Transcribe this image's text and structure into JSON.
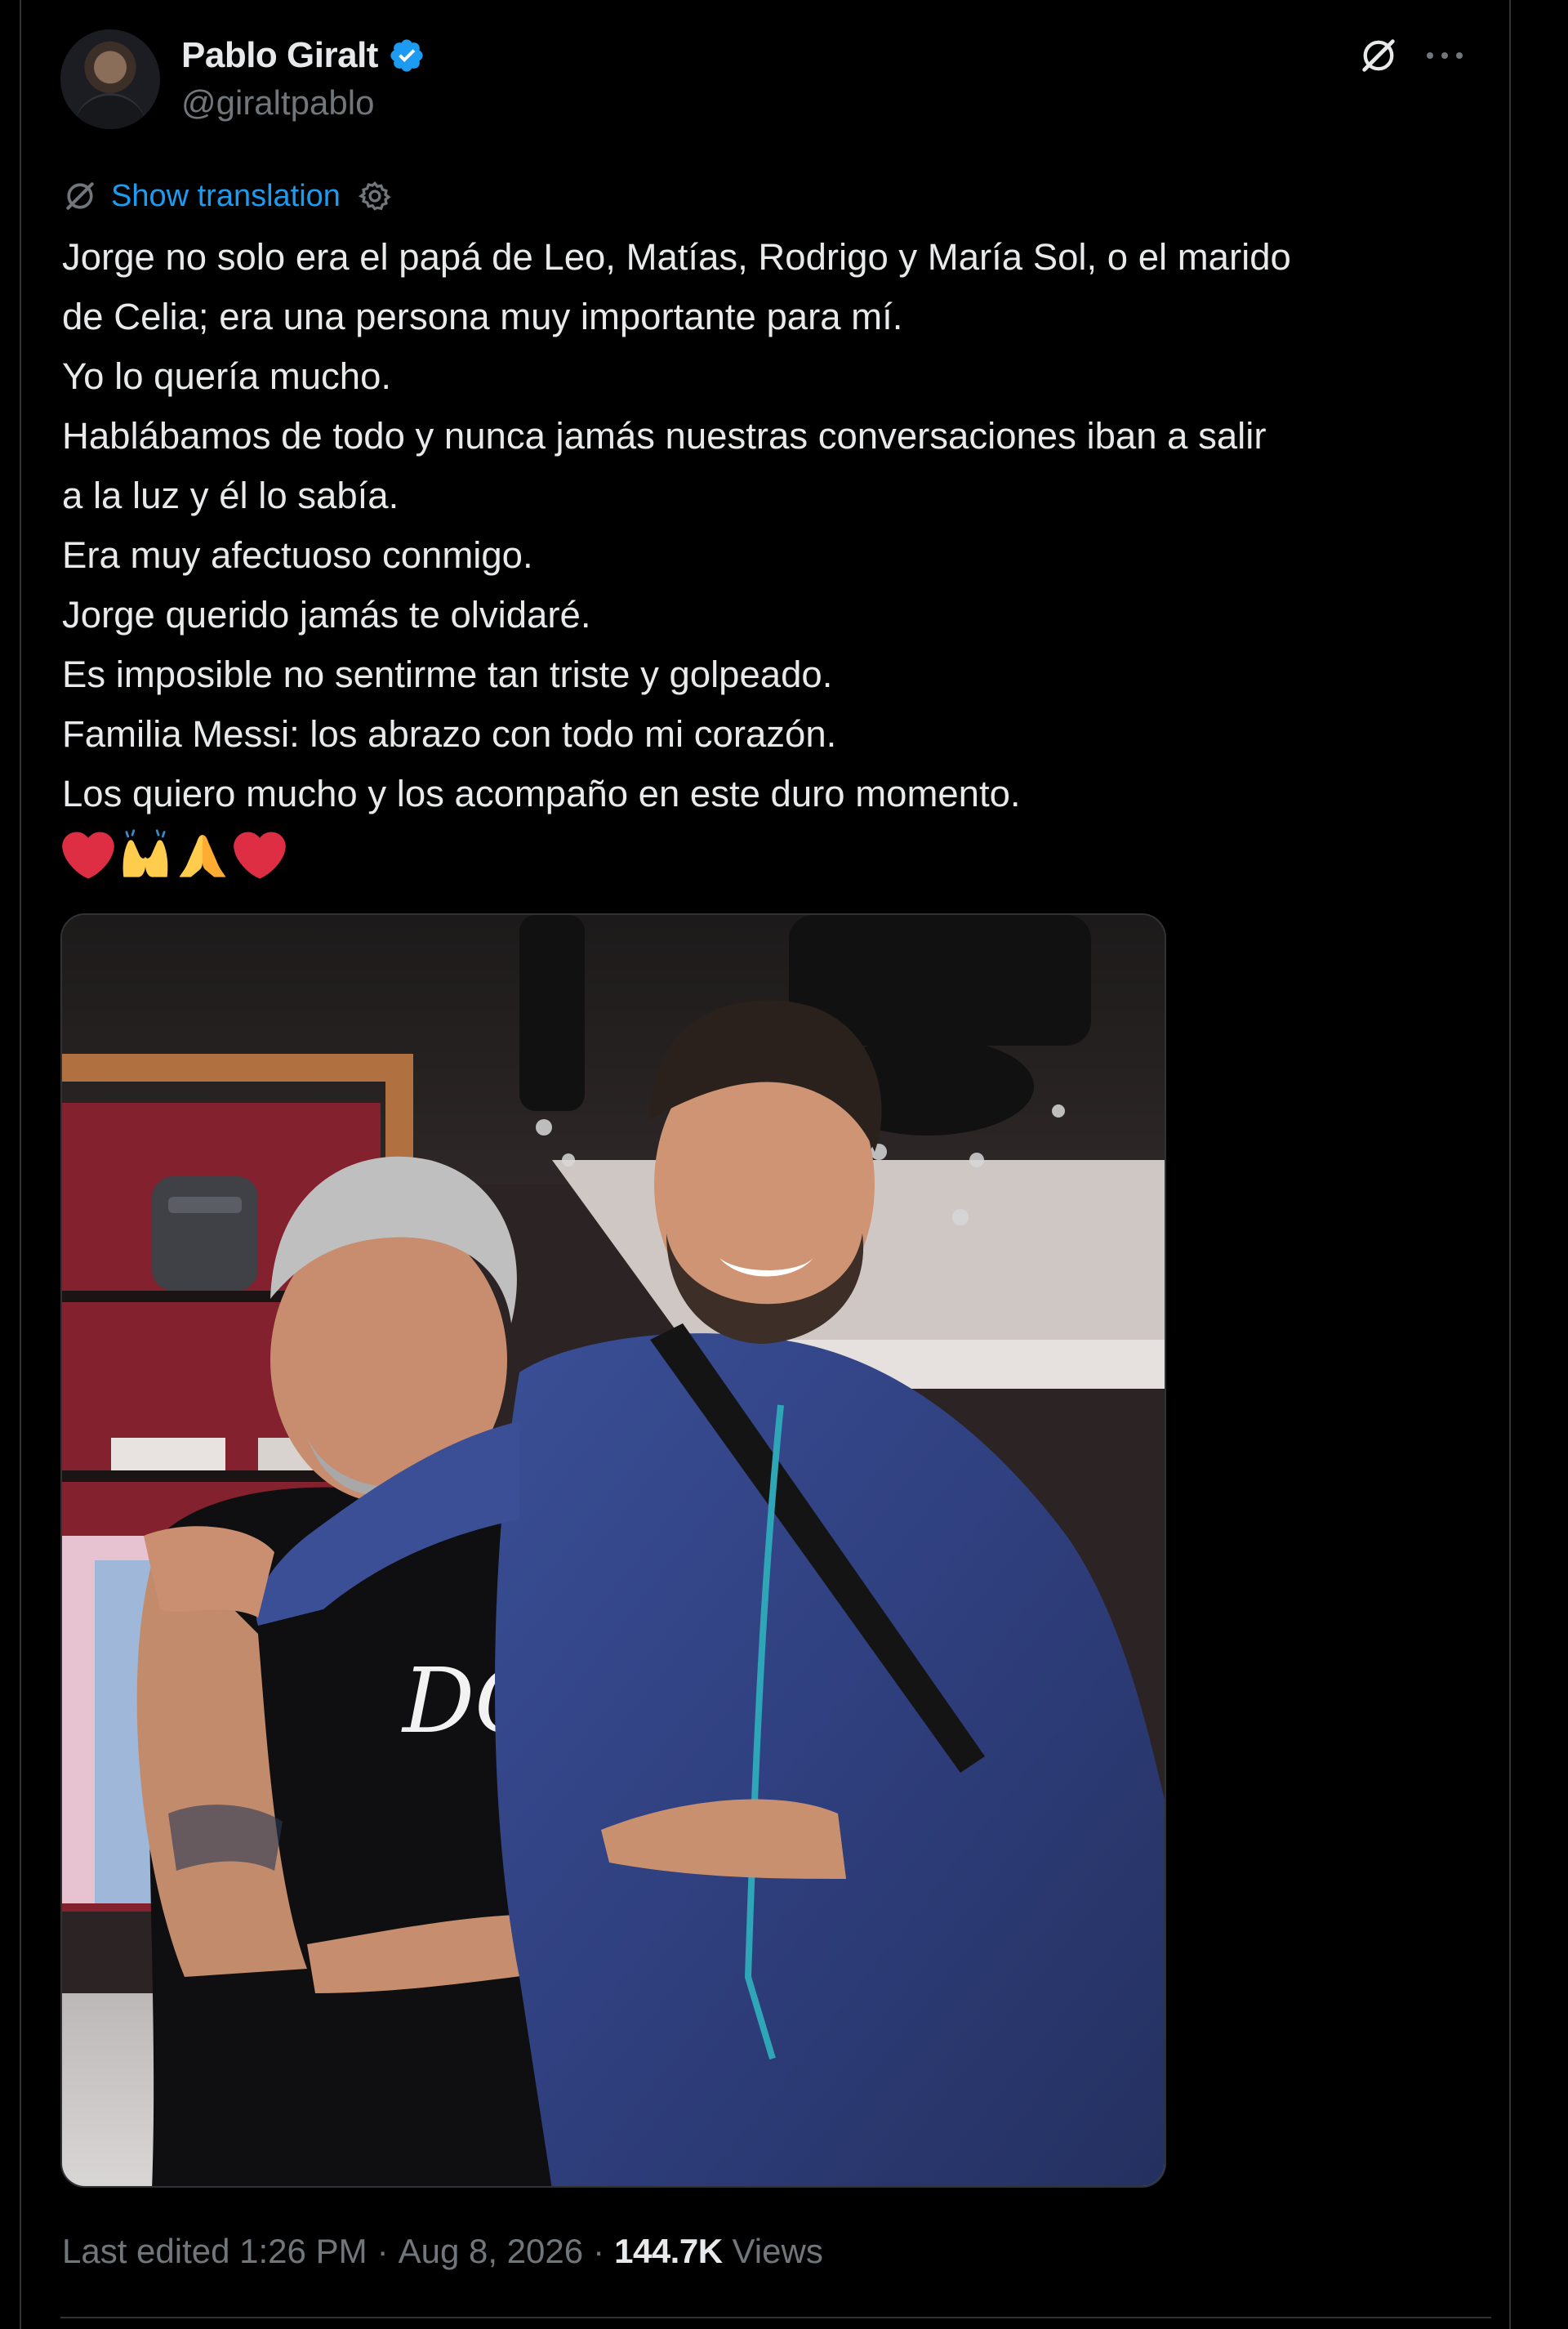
{
  "author": {
    "name": "Pablo Giralt",
    "handle": "@giraltpablo",
    "verified": true,
    "verified_color": "#1d9bf0"
  },
  "actions": {
    "grok_icon": "grok-icon",
    "more_icon": "more-horizontal-icon"
  },
  "translation": {
    "label": "Show translation",
    "color": "#1d9bf0"
  },
  "tweet": {
    "lines": [
      "Jorge no solo era el papá de Leo, Matías, Rodrigo y María Sol, o el marido",
      "de Celia; era una persona muy importante para mí.",
      "Yo lo quería mucho.",
      "Hablábamos de todo y nunca jamás nuestras conversaciones iban a salir",
      "a la luz y él lo sabía.",
      "Era muy afectuoso conmigo.",
      "Jorge querido jamás te olvidaré.",
      "Es imposible no sentirme tan triste y golpeado.",
      "Familia Messi: los abrazo con todo mi corazón.",
      "Los quiero mucho y los acompaño en este duro momento."
    ],
    "emojis": [
      "red-heart",
      "raising-hands",
      "folded-hands",
      "red-heart"
    ]
  },
  "media": {
    "type": "photo",
    "logo_text": "DG"
  },
  "meta": {
    "edited": "Last edited 1:26 PM",
    "separator": "·",
    "date": "Aug 8, 2026",
    "views_count": "144.7K",
    "views_label": "Views"
  },
  "colors": {
    "background": "#000000",
    "text": "#e7e9ea",
    "secondary": "#71767b",
    "border": "#2f3336",
    "accent": "#1d9bf0"
  }
}
